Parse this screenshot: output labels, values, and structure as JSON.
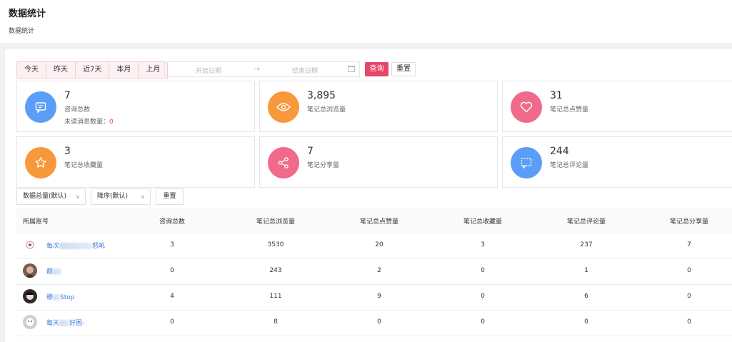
{
  "header": {
    "title": "数据统计",
    "breadcrumb": "数据统计"
  },
  "filters": {
    "quick": [
      "今天",
      "昨天",
      "近7天",
      "本月",
      "上月"
    ],
    "start_placeholder": "开始日期",
    "arrow": "→",
    "end_placeholder": "结束日期",
    "query_label": "查询",
    "reset_label": "重置"
  },
  "stats": {
    "consult": {
      "value": "7",
      "label": "咨询总数",
      "unread_label": "未读消息数量：",
      "unread_value": "0",
      "color": "#5b9ef7"
    },
    "views": {
      "value": "3,895",
      "label": "笔记总浏览量",
      "color": "#f7983b"
    },
    "likes": {
      "value": "31",
      "label": "笔记总点赞量",
      "color": "#f26a8b"
    },
    "favs": {
      "value": "3",
      "label": "笔记总收藏量",
      "color": "#f7983b"
    },
    "shares": {
      "value": "7",
      "label": "笔记分享量",
      "color": "#f26a8b"
    },
    "comments": {
      "value": "244",
      "label": "笔记总评论量",
      "color": "#5b9ef7"
    }
  },
  "sort": {
    "field": "数据总量(默认)",
    "order": "降序(默认)",
    "reset_label": "重置"
  },
  "table": {
    "columns": [
      "所属账号",
      "咨询总数",
      "笔记总浏览量",
      "笔记总点赞量",
      "笔记总收藏量",
      "笔记总评论量",
      "笔记总分享量"
    ],
    "rows": [
      {
        "name_start": "每次",
        "name_end": "怒吼",
        "values": [
          "3",
          "3530",
          "20",
          "3",
          "237",
          "7"
        ]
      },
      {
        "name_start": "靓",
        "name_end": "",
        "values": [
          "0",
          "243",
          "2",
          "0",
          "1",
          "0"
        ]
      },
      {
        "name_start": "穆",
        "name_end": "Stop",
        "values": [
          "4",
          "111",
          "9",
          "0",
          "6",
          "0"
        ]
      },
      {
        "name_start": "每天",
        "name_end": "好困-",
        "values": [
          "0",
          "8",
          "0",
          "0",
          "0",
          "0"
        ]
      }
    ]
  },
  "accent": "#e8456b"
}
